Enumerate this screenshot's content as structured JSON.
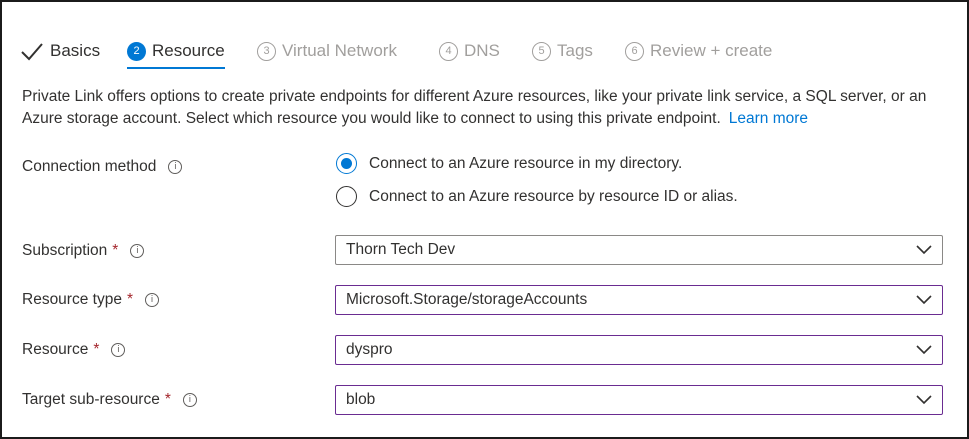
{
  "tabs": [
    {
      "label": "Basics",
      "state": "done",
      "icon": "checkmark-icon"
    },
    {
      "label": "Resource",
      "num": "2",
      "state": "active"
    },
    {
      "label": "Virtual Network",
      "num": "3",
      "state": "inactive"
    },
    {
      "label": "DNS",
      "num": "4",
      "state": "inactive"
    },
    {
      "label": "Tags",
      "num": "5",
      "state": "inactive"
    },
    {
      "label": "Review + create",
      "num": "6",
      "state": "inactive"
    }
  ],
  "description": {
    "text": "Private Link offers options to create private endpoints for different Azure resources, like your private link service, a SQL server, or an Azure storage account. Select which resource you would like to connect to using this private endpoint.",
    "learn_more": "Learn more"
  },
  "form": {
    "connection_method": {
      "label": "Connection method",
      "options": [
        {
          "label": "Connect to an Azure resource in my directory.",
          "checked": true
        },
        {
          "label": "Connect to an Azure resource by resource ID or alias.",
          "checked": false
        }
      ]
    },
    "subscription": {
      "label": "Subscription",
      "required": "*",
      "value": "Thorn Tech Dev"
    },
    "resource_type": {
      "label": "Resource type",
      "required": "*",
      "value": "Microsoft.Storage/storageAccounts"
    },
    "resource": {
      "label": "Resource",
      "required": "*",
      "value": "dyspro"
    },
    "target_sub_resource": {
      "label": "Target sub-resource",
      "required": "*",
      "value": "blob"
    }
  },
  "info_glyph": "i",
  "colors": {
    "accent": "#0078d4",
    "required": "#a4262c",
    "focus_border": "#6a2c91",
    "disabled_text": "#a19f9d"
  }
}
